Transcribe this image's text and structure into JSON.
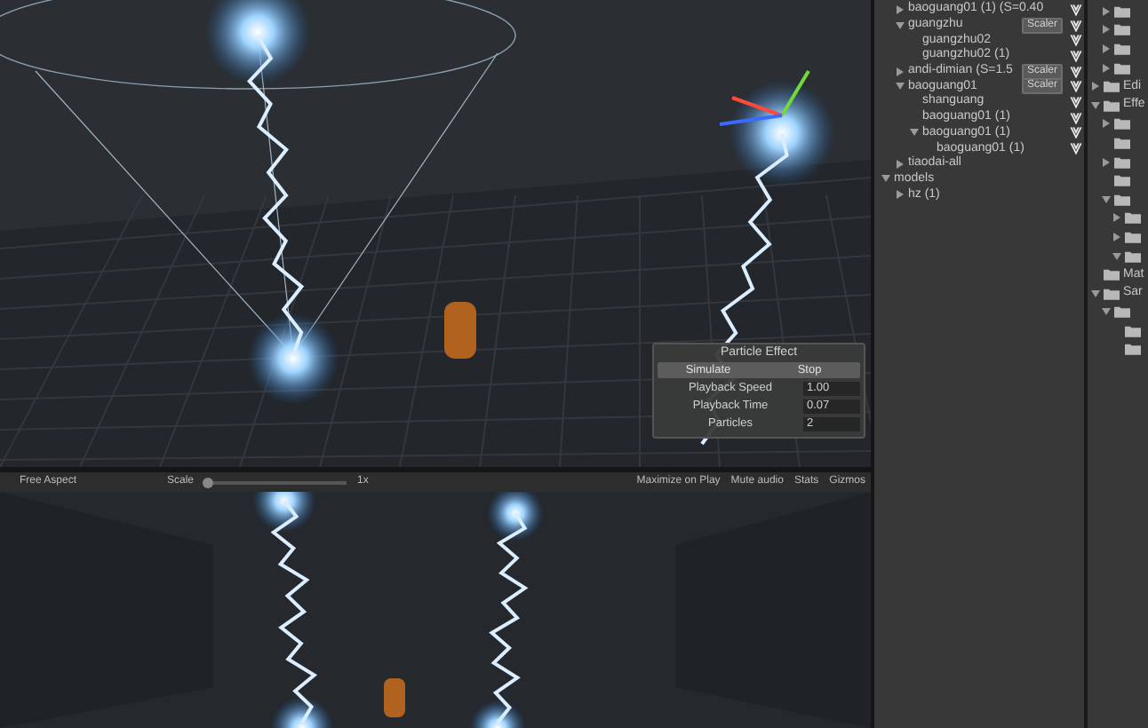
{
  "scene": {
    "particle_panel": {
      "title": "Particle Effect",
      "buttons": [
        "Simulate",
        "Stop"
      ],
      "fields": [
        {
          "label": "Playback Speed",
          "value": "1.00"
        },
        {
          "label": "Playback Time",
          "value": "0.07"
        },
        {
          "label": "Particles",
          "value": "2"
        }
      ]
    }
  },
  "game_toolbar": {
    "aspect": "Free Aspect",
    "scale_label": "Scale",
    "scale": {
      "level": 0.03
    },
    "scale_reading": "1x",
    "toggles": [
      "Maximize on Play",
      "Mute audio",
      "Stats",
      "Gizmos"
    ]
  },
  "hierarchy": {
    "scrolled_items": [
      {
        "label": "baoguang01 (1) (S=0.40",
        "expanded": false,
        "icon": true
      },
      {
        "label": "guangzhu",
        "expanded": true,
        "badge": "Scaler",
        "icon": true,
        "children": [
          {
            "label": "guangzhu02",
            "icon": true
          },
          {
            "label": "guangzhu02 (1)",
            "icon": true
          }
        ]
      },
      {
        "label": "andi-dimian (S=1.5",
        "expanded": false,
        "badge": "Scaler",
        "icon": true
      },
      {
        "label": "baoguang01",
        "expanded": true,
        "badge": "Scaler",
        "icon": true,
        "children": [
          {
            "label": "shanguang",
            "icon": true
          },
          {
            "label": "baoguang01 (1)",
            "icon": true
          },
          {
            "label": "baoguang01 (1)",
            "expanded": true,
            "icon": true,
            "children": [
              {
                "label": "baoguang01 (1)",
                "icon": true
              }
            ]
          }
        ]
      },
      {
        "label": "tiaodai-all",
        "expanded": false,
        "icon": false
      }
    ],
    "items": [
      {
        "label": "models",
        "expanded": true,
        "icon": false,
        "children": [
          {
            "label": "hz (1)",
            "expanded": false,
            "icon": false
          }
        ]
      }
    ]
  },
  "project": {
    "scrolled_items": [
      {
        "expanded": false
      },
      {
        "expanded": false
      },
      {
        "expanded": false
      },
      {
        "expanded": false
      }
    ],
    "items": [
      {
        "label": "Edi",
        "expanded": false
      },
      {
        "label": "Effe",
        "expanded": true,
        "children": [
          {
            "expanded": false
          },
          {
            "leaf": true
          },
          {
            "expanded": false
          },
          {
            "leaf": true
          },
          {
            "expanded": true,
            "children": [
              {
                "expanded": false
              },
              {
                "expanded": false
              },
              {
                "expanded": true
              }
            ]
          }
        ]
      },
      {
        "label": "Mat",
        "leaf": true
      },
      {
        "label": "Sar",
        "expanded": true,
        "children": [
          {
            "expanded": true,
            "children": [
              {
                "leaf": true
              },
              {
                "leaf": true
              }
            ]
          }
        ]
      }
    ]
  }
}
